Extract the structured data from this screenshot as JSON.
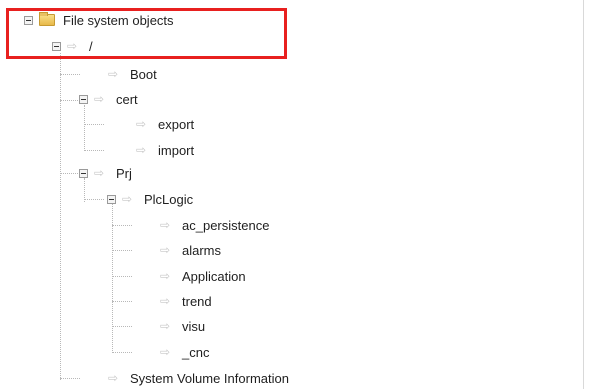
{
  "tree": {
    "root": {
      "label": "File system objects",
      "expanded": true
    },
    "slash": {
      "label": "/",
      "expanded": true
    },
    "boot": {
      "label": "Boot"
    },
    "cert": {
      "label": "cert",
      "expanded": true
    },
    "cert_export": {
      "label": "export"
    },
    "cert_import": {
      "label": "import"
    },
    "prj": {
      "label": "Prj",
      "expanded": true
    },
    "plclogic": {
      "label": "PlcLogic",
      "expanded": true
    },
    "ac_persistence": {
      "label": "ac_persistence"
    },
    "alarms": {
      "label": "alarms"
    },
    "application": {
      "label": "Application"
    },
    "trend": {
      "label": "trend"
    },
    "visu": {
      "label": "visu"
    },
    "cnc": {
      "label": "_cnc"
    },
    "svi": {
      "label": "System Volume Information"
    }
  },
  "icons": {
    "arrow": "⇨",
    "folder": "folder-icon",
    "expand": "minus-box-icon"
  },
  "colors": {
    "highlight": "#e8201f",
    "text": "#1f1f1f",
    "arrow": "#c7c7c7",
    "tree_lines": "#b8b8b8"
  }
}
